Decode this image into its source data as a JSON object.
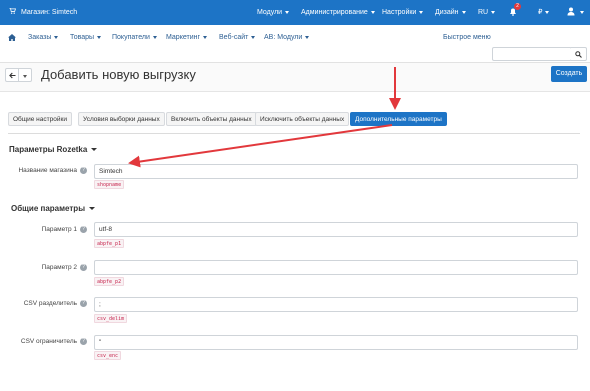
{
  "topbar": {
    "store_name": "Магазин: Simtech",
    "menu": [
      {
        "label": "Модули"
      },
      {
        "label": "Администрирование"
      },
      {
        "label": "Настройки"
      },
      {
        "label": "Дизайн"
      },
      {
        "label": "RU"
      },
      {
        "label": "₽"
      }
    ],
    "notification_count": "2"
  },
  "navbar": {
    "items": [
      {
        "label": "Заказы"
      },
      {
        "label": "Товары"
      },
      {
        "label": "Покупатели"
      },
      {
        "label": "Маркетинг"
      },
      {
        "label": "Веб-сайт"
      },
      {
        "label": "AB: Модули"
      }
    ],
    "quick_menu": "Быстрое меню",
    "search": {
      "value": "",
      "placeholder": ""
    }
  },
  "page": {
    "title": "Добавить новую выгрузку",
    "create_label": "Создать"
  },
  "tabs": [
    {
      "label": "Общие настройки",
      "active": false
    },
    {
      "label": "Условия выборки данных",
      "active": false
    },
    {
      "label": "Включить объекты данных",
      "active": false
    },
    {
      "label": "Исключить объекты данных",
      "active": false
    },
    {
      "label": "Дополнительные параметры",
      "active": true
    }
  ],
  "sections": [
    {
      "title": "Параметры Rozetka",
      "fields": [
        {
          "label": "Название магазина",
          "value": "Simtech",
          "code": "shopname"
        }
      ]
    },
    {
      "title": "Общие параметры",
      "fields": [
        {
          "label": "Параметр 1",
          "value": "utf-8",
          "code": "abpfe_p1"
        },
        {
          "label": "Параметр 2",
          "value": "",
          "code": "abpfe_p2"
        },
        {
          "label": "CSV разделитель",
          "value": ";",
          "code": "csv_delim"
        },
        {
          "label": "CSV ограничитель",
          "value": "\"",
          "code": "csv_enc"
        }
      ]
    }
  ],
  "colors": {
    "accent": "#1d74c6",
    "annotation": "#e2383c"
  }
}
